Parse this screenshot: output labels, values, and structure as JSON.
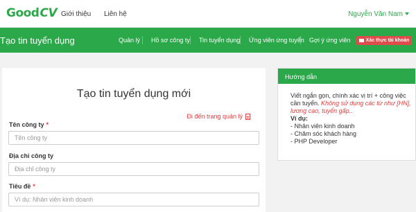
{
  "topnav": {
    "logo_good": "Good",
    "logo_cv": "CV",
    "links": [
      "Giới thiệu",
      "Liên hệ"
    ],
    "user_name": "Nguyễn Văn Nam"
  },
  "greenbar": {
    "title": "Tạo tin tuyển dụng",
    "menu": [
      "Quản lý",
      "Hồ sơ công ty",
      "Tin tuyển dụng",
      "Ứng viên ứng tuyển",
      "Gợi ý ứng viên"
    ],
    "verify_button": "Xác thực tài khoản"
  },
  "form": {
    "title": "Tạo tin tuyển dụng mới",
    "manage_link": "Đi đến trang quản lý",
    "company_name": {
      "label": "Tên công ty",
      "required": "*",
      "placeholder": "Tên công ty",
      "value": ""
    },
    "company_address": {
      "label": "Địa chỉ công ty",
      "placeholder": "Địa chỉ công ty",
      "value": ""
    },
    "job_title": {
      "label": "Tiêu đề",
      "required": "*",
      "placeholder": "Ví dụ: Nhân viên kinh doanh",
      "value": ""
    }
  },
  "guide": {
    "heading": "Hướng dẫn",
    "text1": "Viết ngắn gọn, chính xác vị trí + công việc",
    "text2": "cần tuyển.",
    "warn1": "Không sử dụng các từ như [HN],",
    "warn2": "lương cao, tuyển gấp..",
    "example_label": "Ví dụ:",
    "examples": [
      "- Nhân viên kinh doanh",
      "- Chăm sóc khách hàng",
      "- PHP Developer"
    ]
  },
  "colors": {
    "primary_green": "#2ba84a",
    "danger_red": "#e03c3c",
    "verify_red": "#e04b4b"
  }
}
